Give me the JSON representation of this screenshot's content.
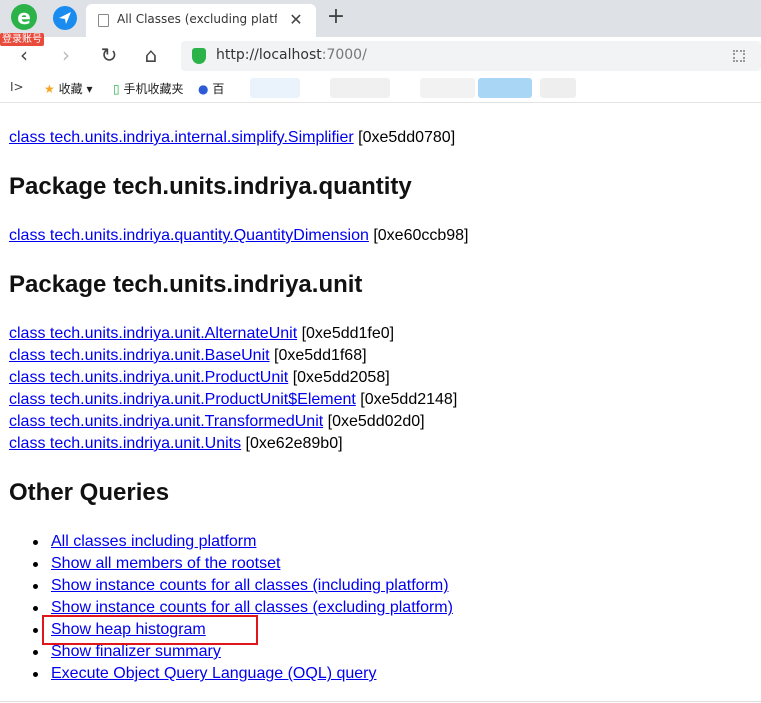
{
  "browser": {
    "login_badge": "登录账号",
    "tab_title": "All Classes (excluding platform)",
    "tab_close": "✕",
    "new_tab": "+",
    "url_host": "http://localhost",
    "url_rest": ":7000/",
    "nav": {
      "back": "‹",
      "forward": "›",
      "reload": "↻",
      "home": "⌂"
    }
  },
  "bookmarks": {
    "toggle": "I>",
    "favorites": "收藏",
    "mobile": "手机收藏夹",
    "baidu": "百"
  },
  "page": {
    "top_classes": [
      {
        "name": "class tech.units.indriya.internal.simplify.Simplifier",
        "addr": " [0xe5dd0780]"
      }
    ],
    "sections": [
      {
        "heading": "Package tech.units.indriya.quantity",
        "classes": [
          {
            "name": "class tech.units.indriya.quantity.QuantityDimension",
            "addr": " [0xe60ccb98]"
          }
        ]
      },
      {
        "heading": "Package tech.units.indriya.unit",
        "classes": [
          {
            "name": "class tech.units.indriya.unit.AlternateUnit",
            "addr": " [0xe5dd1fe0]"
          },
          {
            "name": "class tech.units.indriya.unit.BaseUnit",
            "addr": " [0xe5dd1f68]"
          },
          {
            "name": "class tech.units.indriya.unit.ProductUnit",
            "addr": " [0xe5dd2058]"
          },
          {
            "name": "class tech.units.indriya.unit.ProductUnit$Element",
            "addr": " [0xe5dd2148]"
          },
          {
            "name": "class tech.units.indriya.unit.TransformedUnit",
            "addr": " [0xe5dd02d0]"
          },
          {
            "name": "class tech.units.indriya.unit.Units",
            "addr": " [0xe62e89b0]"
          }
        ]
      }
    ],
    "other_queries": {
      "heading": "Other Queries",
      "links": [
        "All classes including platform",
        "Show all members of the rootset",
        "Show instance counts for all classes (including platform)",
        "Show instance counts for all classes (excluding platform)",
        "Show heap histogram",
        "Show finalizer summary",
        "Execute Object Query Language (OQL) query"
      ]
    }
  }
}
